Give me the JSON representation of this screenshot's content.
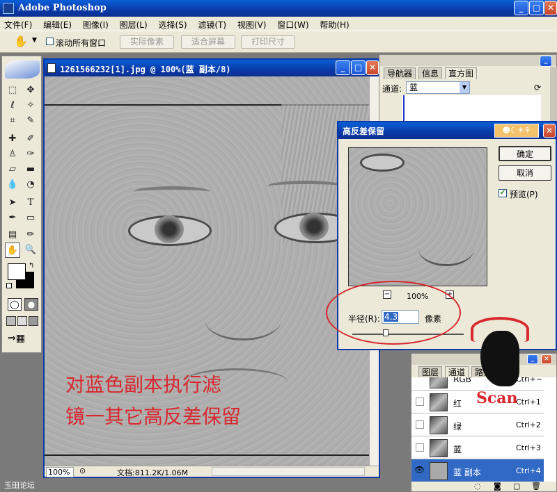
{
  "app": {
    "title": "Adobe Photoshop"
  },
  "menu": [
    "文件(F)",
    "编辑(E)",
    "图像(I)",
    "图层(L)",
    "选择(S)",
    "滤镜(T)",
    "视图(V)",
    "窗口(W)",
    "帮助(H)"
  ],
  "options": {
    "scroll_all": "滚动所有窗口",
    "actual_pixels": "实际像素",
    "fit_screen": "适合屏幕",
    "print_size": "打印尺寸"
  },
  "document": {
    "title": "1261566232[1].jpg @ 100%(蓝 副本/8)",
    "zoom": "100%",
    "doc_info": "文档:811.2K/1.06M"
  },
  "navigator": {
    "tabs": [
      "导航器",
      "信息",
      "直方图"
    ],
    "channel_label": "通道:",
    "channel_value": "蓝"
  },
  "dialog": {
    "title": "高反差保留",
    "ok": "确定",
    "cancel": "取消",
    "preview": "预览(P)",
    "zoom": "100%",
    "radius_label": "半径(R):",
    "radius_value": "4.3",
    "unit": "像素",
    "slider_value": 0.3
  },
  "layers": {
    "tabs": [
      "图层",
      "通道",
      "路径"
    ],
    "rows": [
      {
        "name": "RGB",
        "shortcut": "Ctrl+~"
      },
      {
        "name": "红",
        "shortcut": "Ctrl+1"
      },
      {
        "name": "绿",
        "shortcut": "Ctrl+2"
      },
      {
        "name": "蓝",
        "shortcut": "Ctrl+3"
      },
      {
        "name": "蓝 副本",
        "shortcut": "Ctrl+4"
      }
    ]
  },
  "annotation": {
    "line1": "对蓝色副本执行滤",
    "line2": "镜一其它高反差保留"
  },
  "watermark": {
    "scan": "Scan",
    "forum": "玉田论坛"
  },
  "colors": {
    "annotation": "#d9272e",
    "highlight_circle": "#d9272e",
    "xp_blue": "#0a5fd8"
  }
}
